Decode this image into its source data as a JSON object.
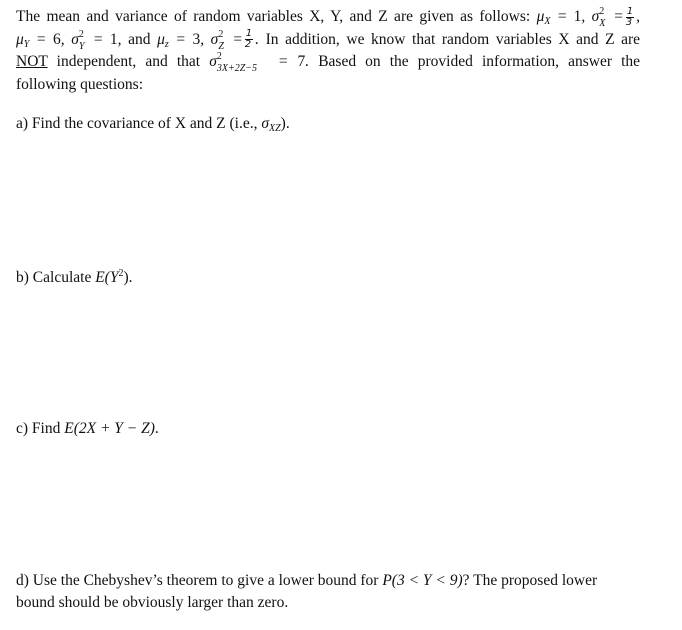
{
  "intro": {
    "line1_text": "The mean and variance of random variables X, Y, and Z are given as follows:",
    "mu_x": "1",
    "var_x_num": "1",
    "var_x_den": "3",
    "mu_y": "6",
    "var_y": "1",
    "and_word": "and",
    "mu_z": "3",
    "var_z_num": "1",
    "var_z_den": "2",
    "line2_tail": "In addition, we know that random variables X and Z are",
    "not_word": "NOT",
    "line3_mid": "independent, and that",
    "var_combo_sub": "3X+2Z−5",
    "var_combo_value": "7",
    "line3_tail": "Based on the provided information, answer the",
    "line4": "following questions:"
  },
  "questions": [
    {
      "label": "a)",
      "text": "Find the covariance of X and Z (i.e., ",
      "math": "σ",
      "sub": "XZ",
      "end": ")."
    },
    {
      "label": "b)",
      "text": "Calculate ",
      "math": "E(Y",
      "sup": "2",
      "end": ")."
    },
    {
      "label": "c)",
      "text": "Find ",
      "math": "E(2X + Y − Z)",
      "end": "."
    },
    {
      "label": "d)",
      "text": "Use the Chebyshev’s theorem to give a lower bound for ",
      "math": "P(3 < Y < 9)",
      "end": "? The proposed lower",
      "line2": "bound should be obviously larger than zero."
    }
  ]
}
